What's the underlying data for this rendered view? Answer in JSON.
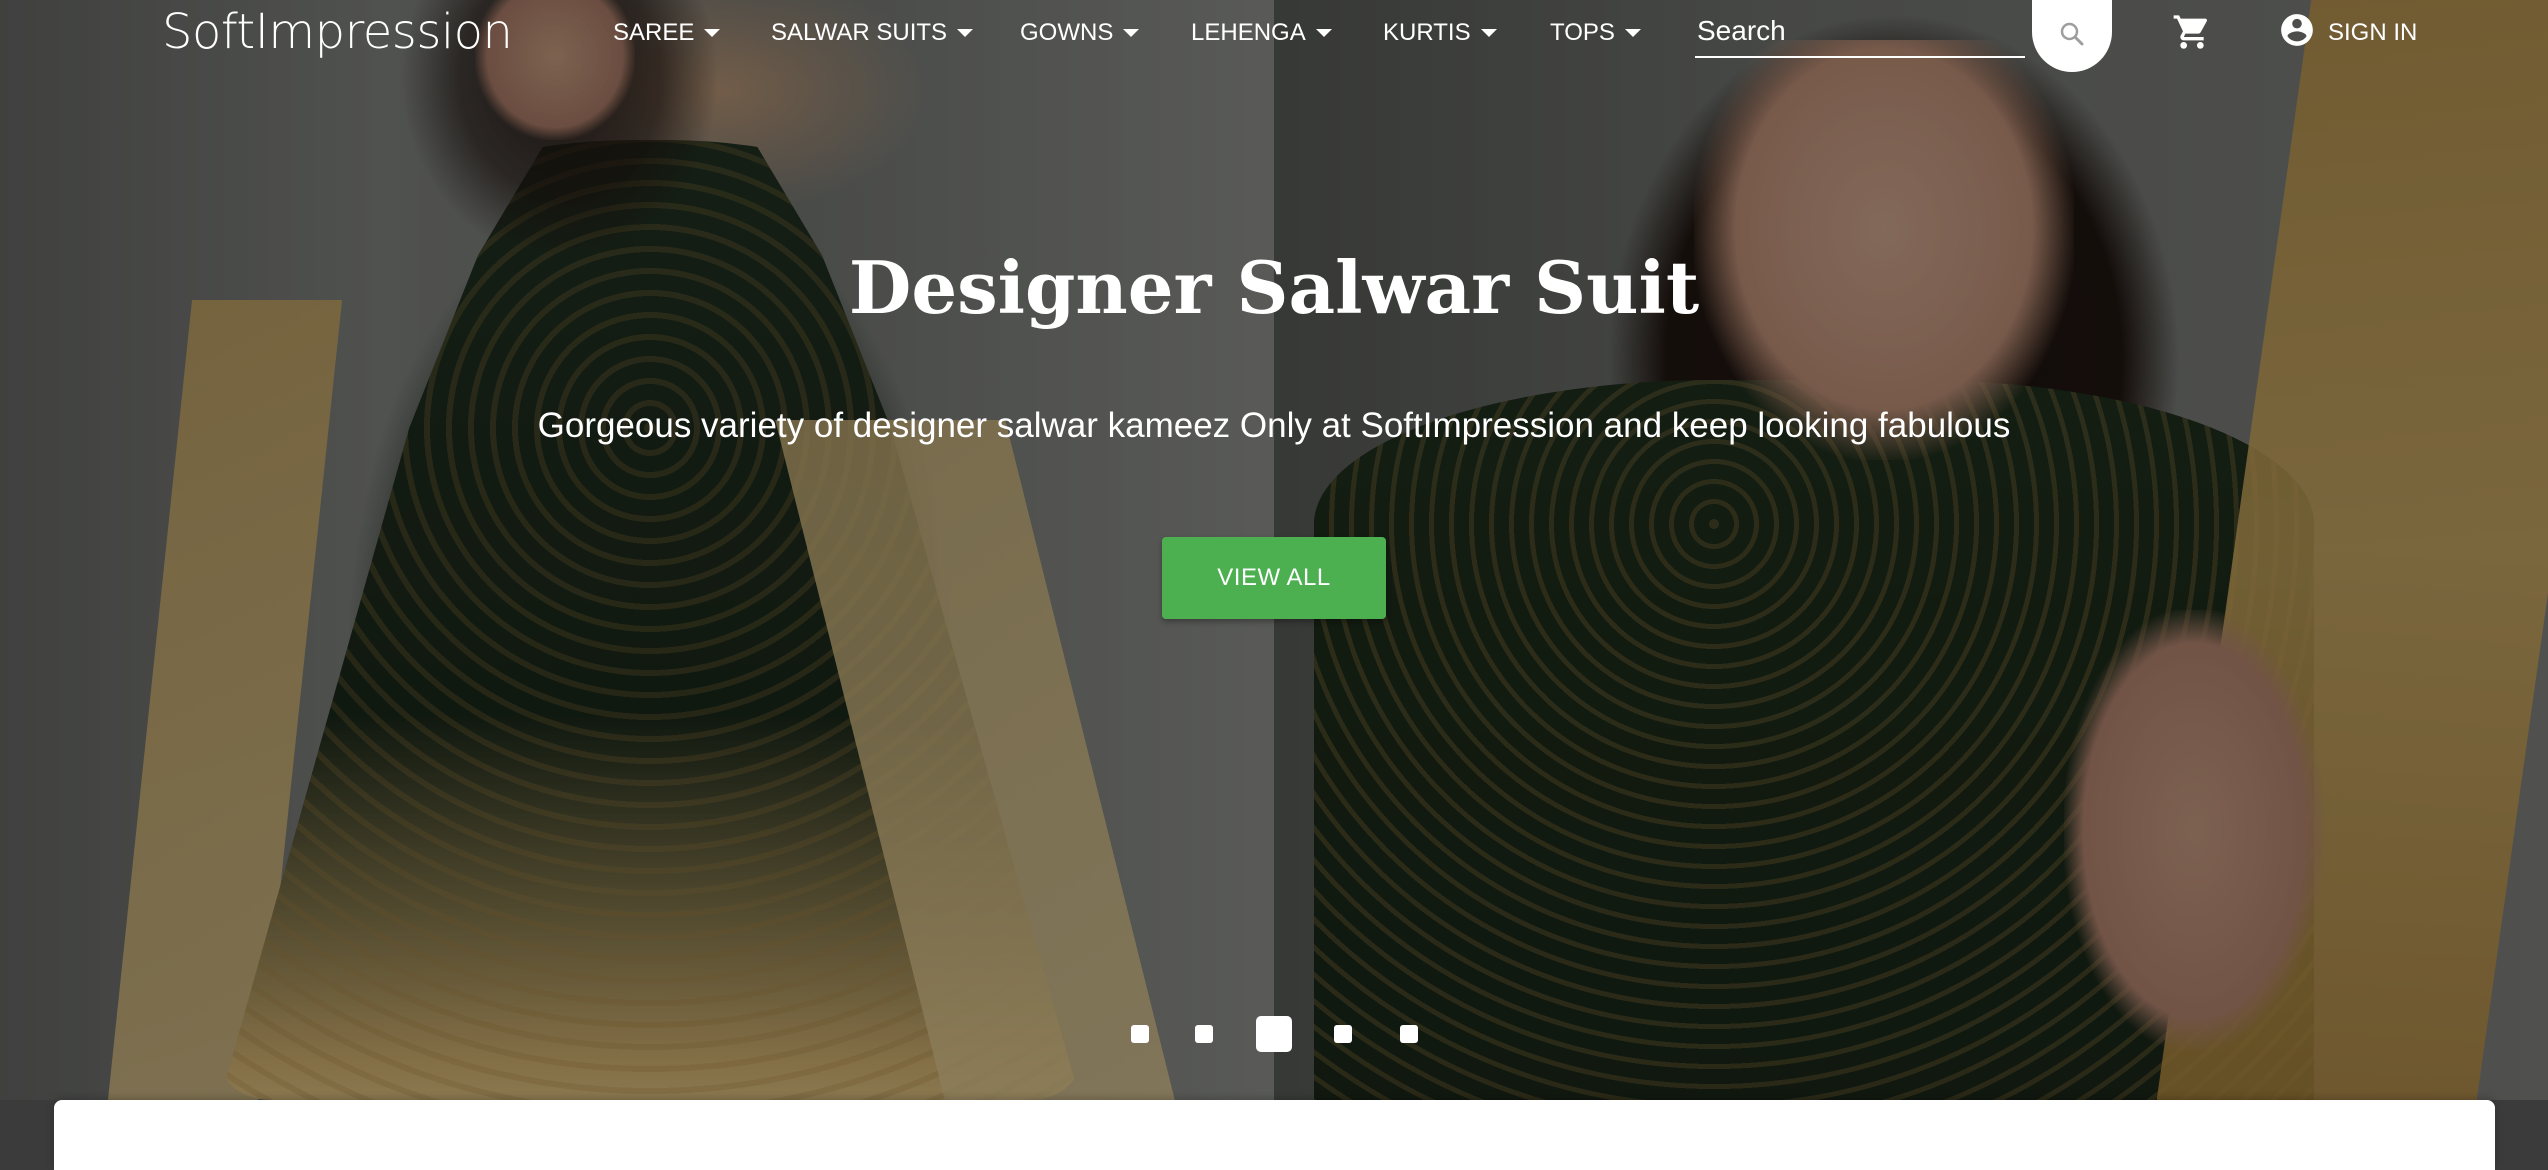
{
  "brand": {
    "name": "SoftImpression"
  },
  "nav": {
    "items": [
      {
        "label": "SAREE"
      },
      {
        "label": "SALWAR SUITS"
      },
      {
        "label": "GOWNS"
      },
      {
        "label": "LEHENGA"
      },
      {
        "label": "KURTIS"
      },
      {
        "label": "TOPS"
      }
    ],
    "search": {
      "placeholder": "Search",
      "value": ""
    },
    "signin_label": "SIGN IN"
  },
  "hero": {
    "title": "Designer Salwar Suit",
    "subtitle": "Gorgeous variety of designer salwar kameez Only at SoftImpression and keep looking fabulous",
    "cta_label": "VIEW ALL",
    "cta_color": "#4caf50"
  },
  "carousel": {
    "slide_count": 5,
    "active_index": 2
  },
  "icons": {
    "search": "search-icon",
    "cart": "cart-icon",
    "account": "account-circle-icon",
    "dropdown": "caret-down-icon"
  }
}
